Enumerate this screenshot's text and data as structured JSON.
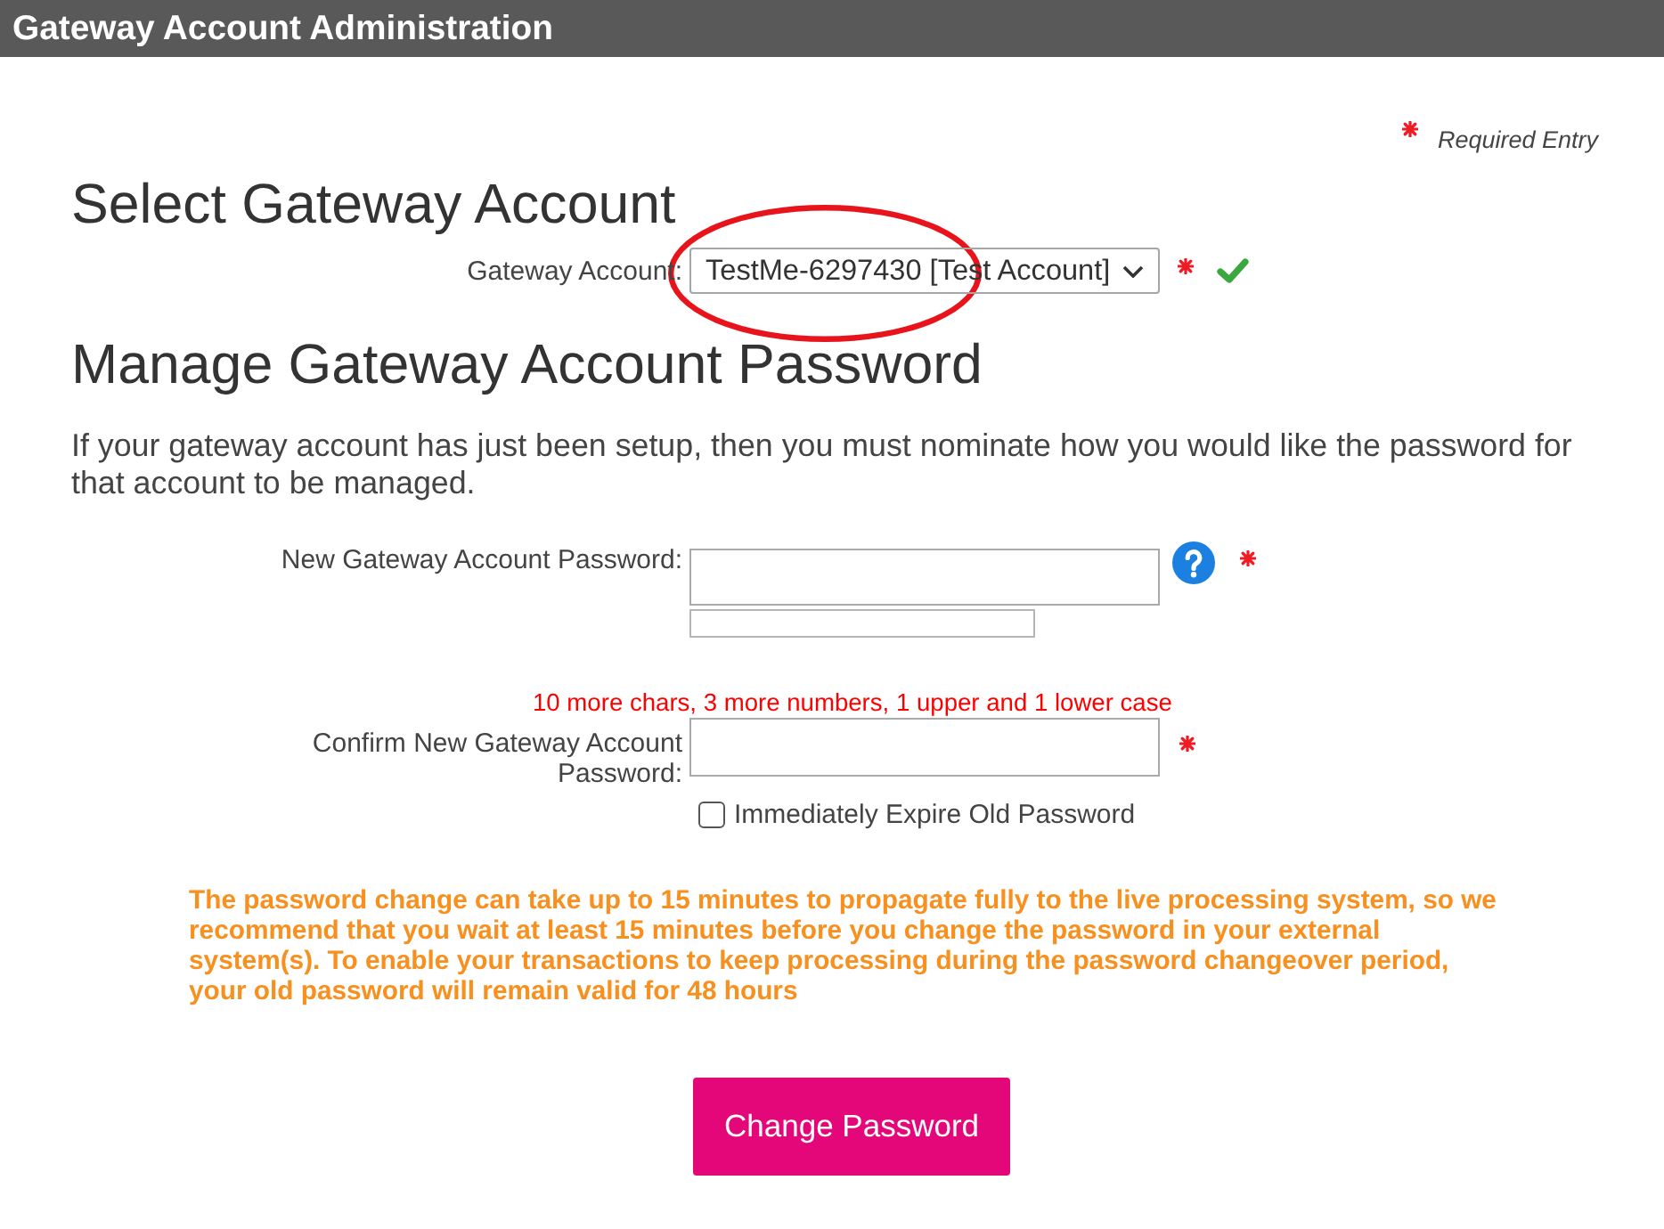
{
  "header": {
    "title": "Gateway Account Administration"
  },
  "legend": {
    "label": "Required Entry"
  },
  "account_section": {
    "heading": "Select Gateway Account",
    "field": {
      "label": "Gateway Account:",
      "value": "TestMe-6297430 [Test Account]",
      "required": true,
      "valid": true,
      "highlighted": true
    }
  },
  "password_section": {
    "heading": "Manage Gateway Account Password",
    "intro": "If your gateway account has just been setup, then you must nominate how you would like the password for that account to be managed.",
    "rows": [
      {
        "kind": "password",
        "label": "New Gateway Account Password:",
        "help": true,
        "required": true,
        "strength_meter": true
      },
      {
        "kind": "message",
        "text": "10 more chars, 3 more numbers, 1 upper and 1 lower case"
      },
      {
        "kind": "password",
        "label": "Confirm New Gateway Account Password:",
        "required": true
      },
      {
        "kind": "checkbox",
        "label": "Immediately Expire Old Password",
        "checked": false
      }
    ]
  },
  "notice": {
    "text": "The password change can take up to 15 minutes to propagate fully to the live processing system, so we recommend that you wait at least 15 minutes before you change the password in your external system(s). To enable your transactions to keep processing during the password changeover period, your old password will remain valid for 48 hours"
  },
  "submit": {
    "label": "Change Password"
  }
}
